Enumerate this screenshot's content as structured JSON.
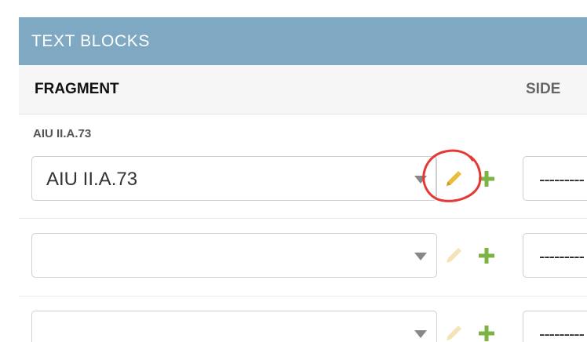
{
  "section": {
    "title": "TEXT BLOCKS"
  },
  "columns": {
    "fragment": "FRAGMENT",
    "side": "SIDE"
  },
  "rows": [
    {
      "label": "AIU II.A.73",
      "fragment_value": "AIU II.A.73",
      "side_value": "---------",
      "edit_enabled": true
    },
    {
      "label": "",
      "fragment_value": "",
      "side_value": "---------",
      "edit_enabled": false
    },
    {
      "label": "",
      "fragment_value": "",
      "side_value": "---------",
      "edit_enabled": false
    }
  ],
  "icons": {
    "edit": "pencil-icon",
    "add": "plus-icon",
    "dropdown": "caret-down-icon"
  },
  "colors": {
    "header_bg": "#7fa9c3",
    "edit_active": "#e8bd3a",
    "edit_disabled": "#f4e3b5",
    "add": "#7cb342",
    "annotation": "#e53935"
  }
}
